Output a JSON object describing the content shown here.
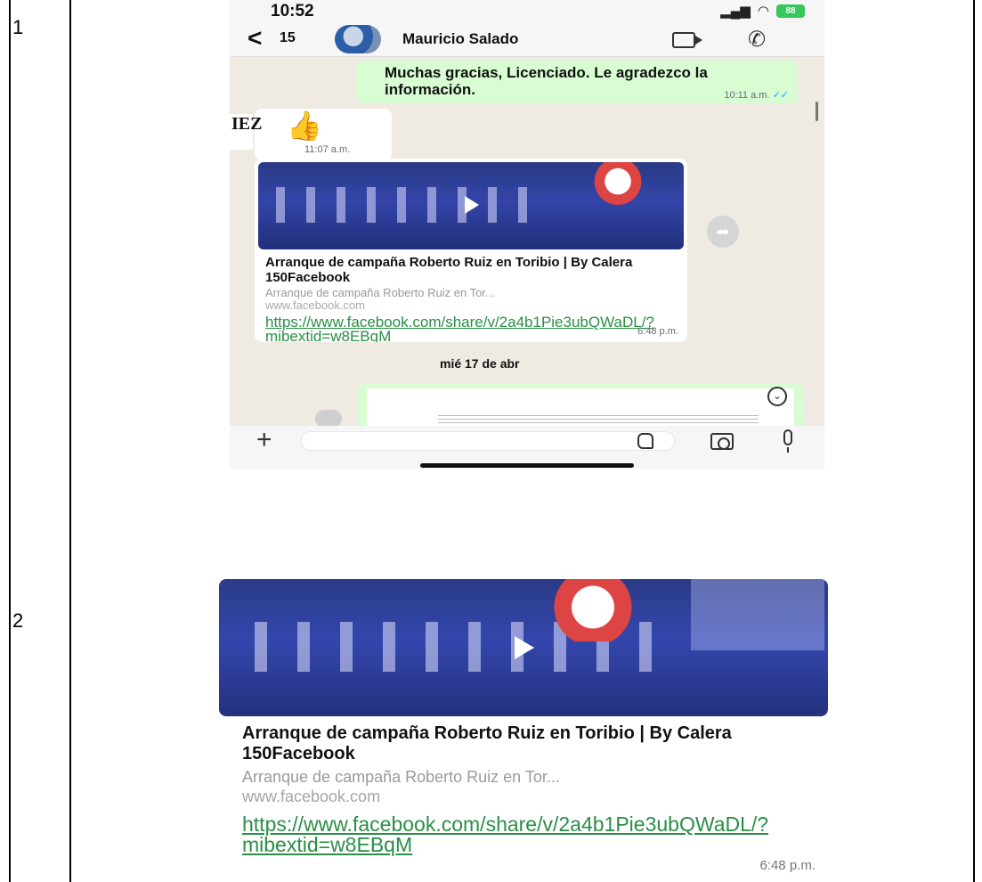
{
  "rows": [
    {
      "number": "1"
    },
    {
      "number": "2"
    }
  ],
  "status_bar": {
    "time": "10:52",
    "battery": "88"
  },
  "chat_header": {
    "back_count": "15",
    "contact_name": "Mauricio Salado"
  },
  "messages": {
    "outgoing_text": "Muchas gracias, Licenciado. Le agradezco la información.",
    "outgoing_time": "10:11 a.m.",
    "thumbs_time": "11:07 a.m.",
    "side_logo_text": "IEZ",
    "link_preview": {
      "title": "Arranque de campaña Roberto Ruiz en Toribio | By Calera 150Facebook",
      "description": "Arranque de campaña Roberto Ruiz en Tor...",
      "domain": "www.facebook.com",
      "url": "https://www.facebook.com/share/v/2a4b1Pie3ubQWaDL/?mibextid=w8EBqM",
      "time": "6:48 p.m."
    },
    "date_separator": "mié 17 de abr"
  },
  "colors": {
    "chat_background": "#efeae2",
    "outgoing_bubble": "#d9fdd3",
    "link_green": "#2a8e47",
    "read_ticks": "#53bdeb"
  },
  "icons": [
    "back-chevron-icon",
    "video-call-icon",
    "phone-call-icon",
    "thumbs-up-icon",
    "play-icon",
    "forward-icon",
    "chevron-down-icon",
    "plus-icon",
    "sticker-icon",
    "camera-icon",
    "microphone-icon"
  ]
}
